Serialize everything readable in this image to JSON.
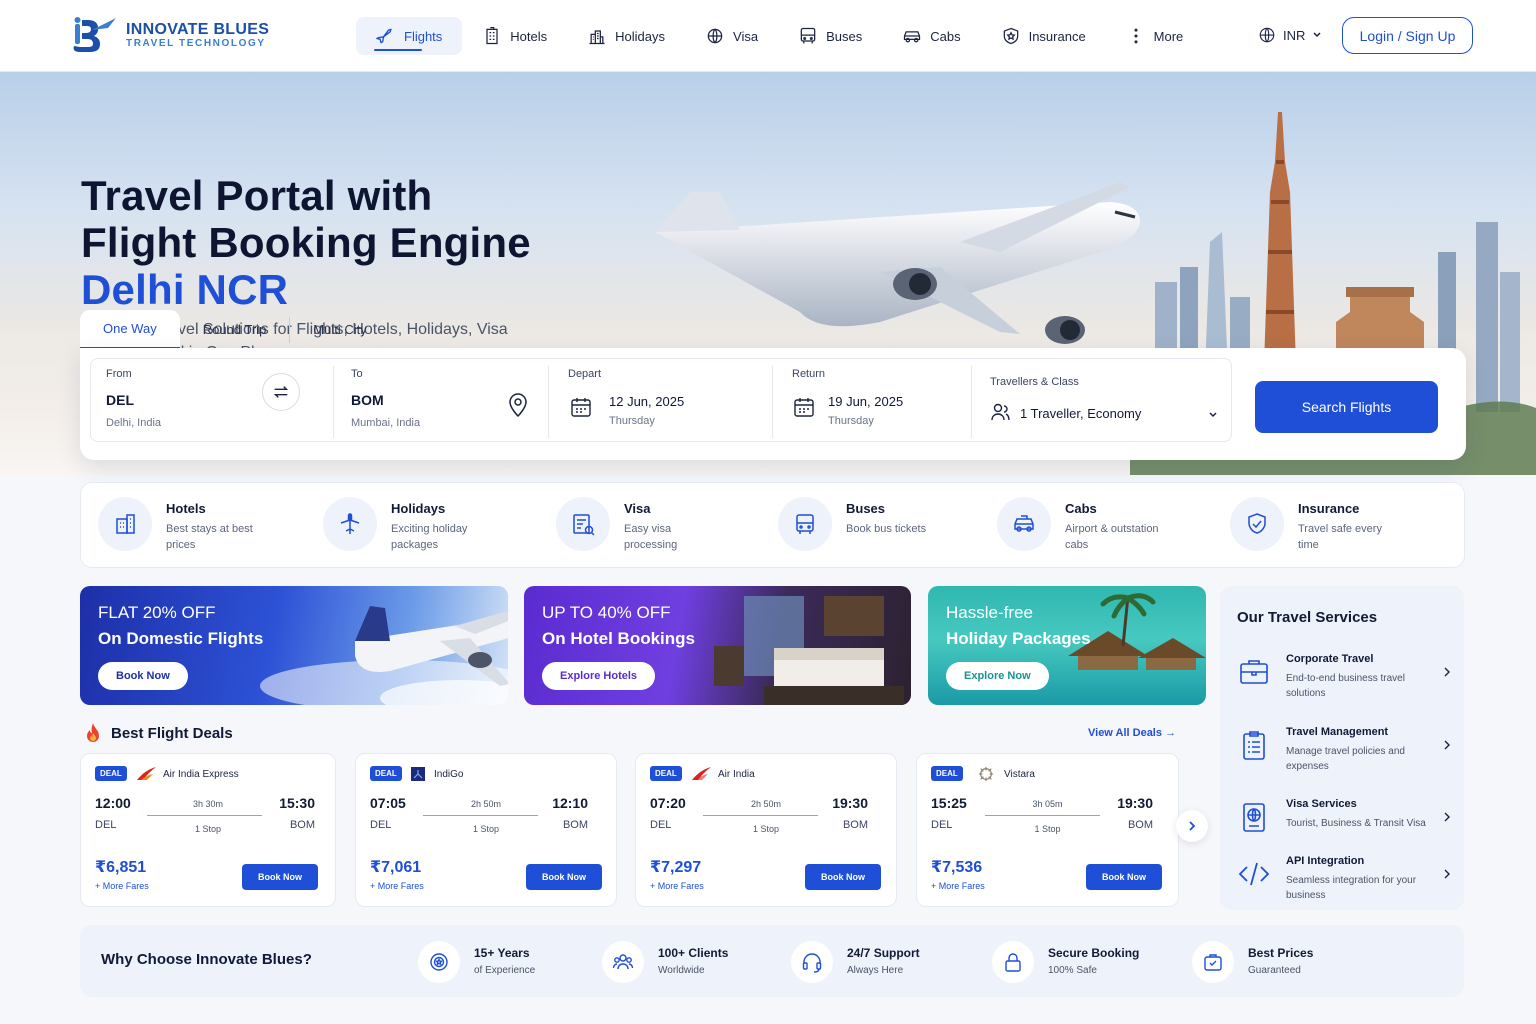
{
  "brand": {
    "name": "INNOVATE BLUES",
    "tagline": "TRAVEL TECHNOLOGY"
  },
  "nav": [
    {
      "label": "Flights",
      "icon": "plane-icon"
    },
    {
      "label": "Hotels",
      "icon": "hotel-icon"
    },
    {
      "label": "Holidays",
      "icon": "holidays-icon"
    },
    {
      "label": "Visa",
      "icon": "visa-icon"
    },
    {
      "label": "Buses",
      "icon": "bus-icon"
    },
    {
      "label": "Cabs",
      "icon": "cab-icon"
    },
    {
      "label": "Insurance",
      "icon": "insurance-icon"
    },
    {
      "label": "More",
      "icon": "more-icon"
    }
  ],
  "currency": "INR",
  "login_label": "Login / Sign Up",
  "hero": {
    "title_line1": "Travel Portal with",
    "title_line2": "Flight Booking Engine",
    "title_line3": "Delhi NCR",
    "subtitle": "Complete Travel Solutions for Flights, Hotels, Holidays, Visa and more – All in One Place."
  },
  "trip_tabs": [
    "One Way",
    "Round Trip",
    "Multi City"
  ],
  "search": {
    "from_label": "From",
    "from_code": "DEL",
    "from_city": "Delhi, India",
    "to_label": "To",
    "to_code": "BOM",
    "to_city": "Mumbai, India",
    "depart_label": "Depart",
    "depart_date": "12 Jun, 2025",
    "depart_day": "Thursday",
    "return_label": "Return",
    "return_date": "19 Jun, 2025",
    "return_day": "Thursday",
    "travellers_label": "Travellers & Class",
    "travellers_value": "1 Traveller, Economy",
    "button": "Search Flights"
  },
  "services": [
    {
      "title": "Hotels",
      "desc": "Best stays at best prices"
    },
    {
      "title": "Holidays",
      "desc": "Exciting holiday packages"
    },
    {
      "title": "Visa",
      "desc": "Easy visa processing"
    },
    {
      "title": "Buses",
      "desc": "Book bus tickets"
    },
    {
      "title": "Cabs",
      "desc": "Airport & outstation cabs"
    },
    {
      "title": "Insurance",
      "desc": "Travel safe every time"
    }
  ],
  "promos": [
    {
      "line1": "FLAT 20% OFF",
      "line2": "On Domestic Flights",
      "button": "Book Now"
    },
    {
      "line1": "UP TO 40% OFF",
      "line2": "On Hotel Bookings",
      "button": "Explore Hotels"
    },
    {
      "line1": "Hassle-free",
      "line2": "Holiday Packages",
      "button": "Explore Now"
    }
  ],
  "deals_title": "Best Flight Deals",
  "deals_link": "View All Deals →",
  "deals": [
    {
      "badge": "DEAL",
      "airline": "Air India Express",
      "dep": "12:00",
      "arr": "15:30",
      "from": "DEL",
      "to": "BOM",
      "duration": "3h 30m",
      "stops": "1 Stop",
      "price": "₹6,851",
      "more": "+ More Fares",
      "button": "Book Now"
    },
    {
      "badge": "DEAL",
      "airline": "IndiGo",
      "dep": "07:05",
      "arr": "12:10",
      "from": "DEL",
      "to": "BOM",
      "duration": "2h 50m",
      "stops": "1 Stop",
      "price": "₹7,061",
      "more": "+ More Fares",
      "button": "Book Now"
    },
    {
      "badge": "DEAL",
      "airline": "Air India",
      "dep": "07:20",
      "arr": "19:30",
      "from": "DEL",
      "to": "BOM",
      "duration": "2h 50m",
      "stops": "1 Stop",
      "price": "₹7,297",
      "more": "+ More Fares",
      "button": "Book Now"
    },
    {
      "badge": "DEAL",
      "airline": "Vistara",
      "dep": "15:25",
      "arr": "19:30",
      "from": "DEL",
      "to": "BOM",
      "duration": "3h 05m",
      "stops": "1 Stop",
      "price": "₹7,536",
      "more": "+ More Fares",
      "button": "Book Now"
    }
  ],
  "panel": {
    "title": "Our Travel Services",
    "items": [
      {
        "title": "Corporate Travel",
        "desc": "End-to-end business travel solutions"
      },
      {
        "title": "Travel Management",
        "desc": "Manage travel policies and expenses"
      },
      {
        "title": "Visa Services",
        "desc": "Tourist, Business & Transit Visa"
      },
      {
        "title": "API Integration",
        "desc": "Seamless integration for your business"
      }
    ]
  },
  "why": {
    "title": "Why Choose Innovate Blues?",
    "items": [
      {
        "title": "15+ Years",
        "desc": "of Experience"
      },
      {
        "title": "100+ Clients",
        "desc": "Worldwide"
      },
      {
        "title": "24/7 Support",
        "desc": "Always Here"
      },
      {
        "title": "Secure Booking",
        "desc": "100% Safe"
      },
      {
        "title": "Best Prices",
        "desc": "Guaranteed"
      }
    ]
  },
  "colors": {
    "primary": "#1f4fd6",
    "dark": "#0d1530",
    "panel": "#eef2fa"
  }
}
